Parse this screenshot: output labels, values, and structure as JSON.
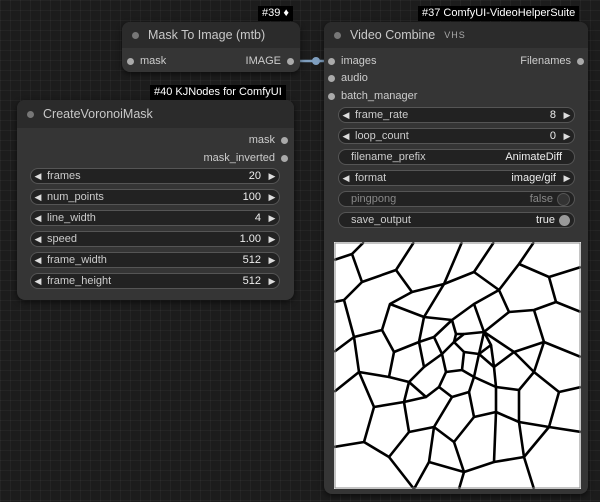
{
  "badges": {
    "id39": "#39 ",
    "id37": "#37 ComfyUI-VideoHelperSuite",
    "id40": "#40 KJNodes for ComfyUI"
  },
  "mask_to_image": {
    "title": "Mask To Image (mtb)",
    "input": "mask",
    "output": "IMAGE"
  },
  "voronoi": {
    "title": "CreateVoronoiMask",
    "outputs": [
      "mask",
      "mask_inverted"
    ],
    "widgets": [
      {
        "label": "frames",
        "value": "20"
      },
      {
        "label": "num_points",
        "value": "100"
      },
      {
        "label": "line_width",
        "value": "4"
      },
      {
        "label": "speed",
        "value": "1.00"
      },
      {
        "label": "frame_width",
        "value": "512"
      },
      {
        "label": "frame_height",
        "value": "512"
      }
    ]
  },
  "video_combine": {
    "title": "Video Combine",
    "title_icons": "VHS",
    "inputs": [
      "images",
      "audio",
      "batch_manager"
    ],
    "output": "Filenames",
    "widgets": {
      "frame_rate": {
        "label": "frame_rate",
        "value": "8"
      },
      "loop_count": {
        "label": "loop_count",
        "value": "0"
      },
      "filename_prefix": {
        "label": "filename_prefix",
        "value": "AnimateDiff"
      },
      "format": {
        "label": "format",
        "value": "image/gif"
      },
      "pingpong": {
        "label": "pingpong",
        "value": "false"
      },
      "save_output": {
        "label": "save_output",
        "value": "true"
      }
    }
  },
  "colors": {
    "canvas": "#1c1c1c",
    "node_body": "#353535",
    "node_title": "#2b2b2b",
    "widget_bg": "#222222",
    "link": "#7f9fbf"
  }
}
